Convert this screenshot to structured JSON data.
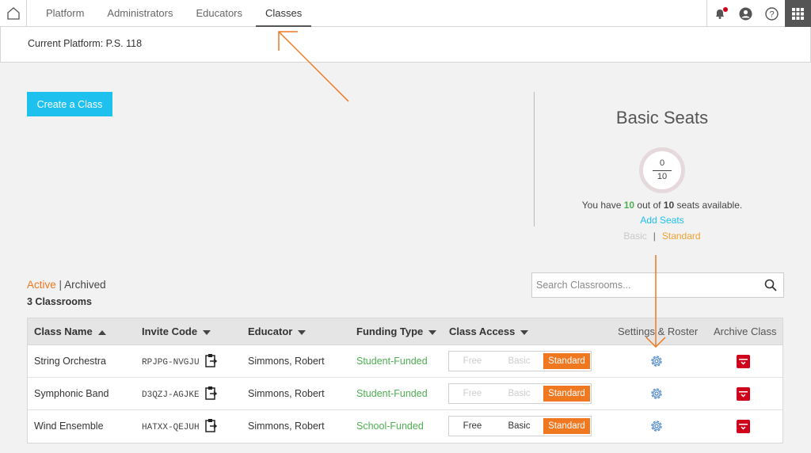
{
  "nav": {
    "tabs": [
      {
        "label": "Platform"
      },
      {
        "label": "Administrators"
      },
      {
        "label": "Educators"
      },
      {
        "label": "Classes",
        "active": true
      }
    ],
    "icons": [
      "home-icon",
      "bell-icon",
      "user-icon",
      "help-icon",
      "apps-grid-icon"
    ]
  },
  "platform": {
    "label": "Current Platform: P.S. 118"
  },
  "create_button": "Create a Class",
  "seats": {
    "title": "Basic Seats",
    "used": "0",
    "total": "10",
    "msg_prefix": "You have",
    "available": "10",
    "msg_mid": "out of",
    "total_bold": "10",
    "msg_suffix": "seats available.",
    "add_seats": "Add Seats",
    "tier_basic": "Basic",
    "tier_sep": "|",
    "tier_standard": "Standard"
  },
  "filters": {
    "active": "Active",
    "sep": "|",
    "archived": "Archived",
    "count": "3 Classrooms"
  },
  "search": {
    "placeholder": "Search Classrooms..."
  },
  "table": {
    "headers": {
      "class_name": "Class Name",
      "invite_code": "Invite Code",
      "educator": "Educator",
      "funding_type": "Funding Type",
      "class_access": "Class Access",
      "settings": "Settings & Roster",
      "archive": "Archive Class"
    },
    "rows": [
      {
        "name": "String Orchestra",
        "code": "RPJPG-NVGJU",
        "educator": "Simmons, Robert",
        "funding": "Student-Funded",
        "free": "Free",
        "basic": "Basic",
        "standard": "Standard",
        "enabled": false
      },
      {
        "name": "Symphonic Band",
        "code": "D3QZJ-AGJKE",
        "educator": "Simmons, Robert",
        "funding": "Student-Funded",
        "free": "Free",
        "basic": "Basic",
        "standard": "Standard",
        "enabled": false
      },
      {
        "name": "Wind Ensemble",
        "code": "HATXX-QEJUH",
        "educator": "Simmons, Robert",
        "funding": "School-Funded",
        "free": "Free",
        "basic": "Basic",
        "standard": "Standard",
        "enabled": true
      }
    ]
  },
  "colors": {
    "accent": "#1ec0ee",
    "orange": "#f07820",
    "green": "#4caf50",
    "archive_red": "#d0021b"
  }
}
